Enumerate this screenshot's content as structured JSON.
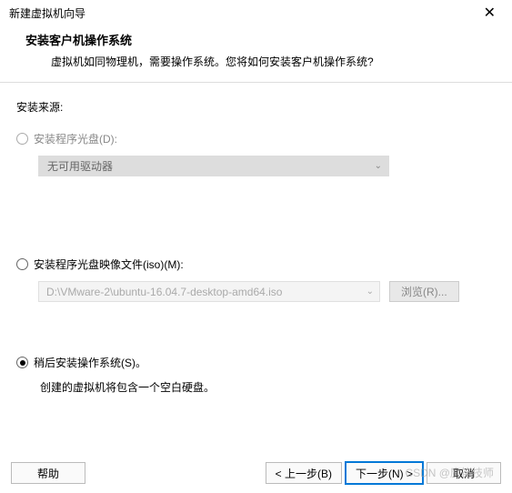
{
  "window": {
    "title": "新建虚拟机向导",
    "close_glyph": "✕"
  },
  "header": {
    "title": "安装客户机操作系统",
    "desc": "虚拟机如同物理机，需要操作系统。您将如何安装客户机操作系统?"
  },
  "source_label": "安装来源:",
  "option_disc": {
    "label": "安装程序光盘(D):",
    "dropdown_value": "无可用驱动器",
    "dropdown_arrow": "⌄"
  },
  "option_iso": {
    "label": "安装程序光盘映像文件(iso)(M):",
    "path": "D:\\VMware-2\\ubuntu-16.04.7-desktop-amd64.iso",
    "dropdown_arrow": "⌄",
    "browse_label": "浏览(R)..."
  },
  "option_later": {
    "label": "稍后安装操作系统(S)。",
    "desc": "创建的虚拟机将包含一个空白硬盘。"
  },
  "footer": {
    "help": "帮助",
    "back": "< 上一步(B)",
    "next": "下一步(N) >",
    "cancel": "取消"
  },
  "watermark": "CSDN @魔笛技师"
}
